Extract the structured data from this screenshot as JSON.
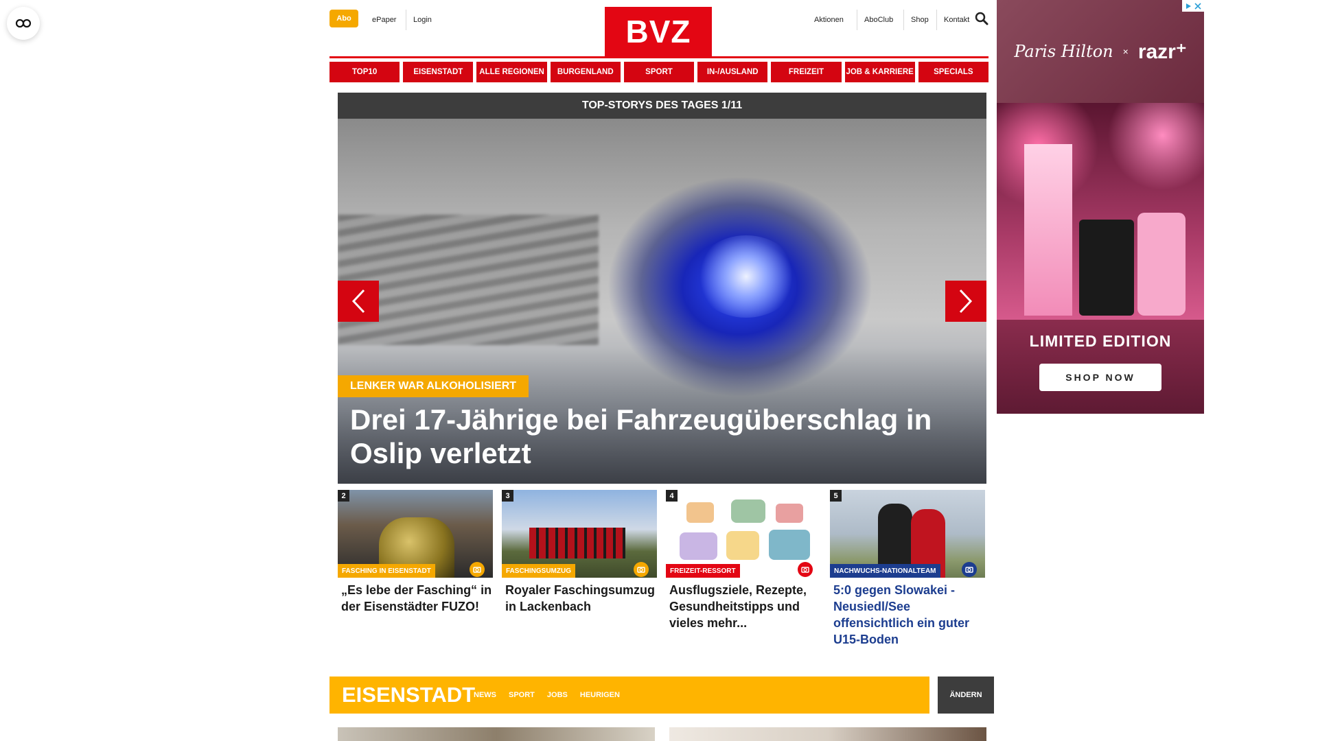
{
  "header": {
    "abo_label": "Abo",
    "left_links": [
      "ePaper",
      "Login"
    ],
    "logo_text": "BVZ",
    "right_links": [
      "Aktionen",
      "AboClub",
      "Shop",
      "Kontakt"
    ]
  },
  "nav": {
    "items": [
      "TOP10",
      "EISENSTADT",
      "ALLE REGIONEN",
      "BURGENLAND",
      "SPORT",
      "IN-/AUSLAND",
      "FREIZEIT",
      "JOB & KARRIERE",
      "SPECIALS"
    ]
  },
  "top_stories": {
    "heading": "TOP-STORYS DES TAGES 1/11",
    "kicker": "LENKER WAR ALKOHOLISIERT",
    "title": "Drei 17-Jährige bei Fahrzeugüberschlag in Oslip verletzt"
  },
  "teasers": [
    {
      "number": "2",
      "tag": "FASCHING IN EISENSTADT",
      "title": "„Es lebe der Fasching“ in der Eisenstädter FUZO!",
      "tag_color": "#f5a800"
    },
    {
      "number": "3",
      "tag": "FASCHINGSUMZUG",
      "title": "Royaler Faschingsumzug in Lackenbach",
      "tag_color": "#f5a800"
    },
    {
      "number": "4",
      "tag": "FREIZEIT-RESSORT",
      "title": "Ausflugsziele, Rezepte, Gesundheitstipps und vieles mehr...",
      "tag_color": "#e30613"
    },
    {
      "number": "5",
      "tag": "NACHWUCHS-NATIONALTEAM",
      "title": "5:0 gegen Slowakei - Neusiedl/See offensichtlich ein guter U15-Boden",
      "tag_color": "#1c3d8f"
    }
  ],
  "ad": {
    "script_text": "Paris Hilton",
    "x_text": "×",
    "brand": "razr⁺",
    "headline": "LIMITED EDITION",
    "cta": "SHOP NOW"
  },
  "region": {
    "name": "EISENSTADT",
    "links": [
      "NEWS",
      "SPORT",
      "JOBS",
      "HEURIGEN"
    ],
    "change_label": "ÄNDERN"
  },
  "colors": {
    "brand_red": "#e30613",
    "accent_yellow": "#f5a800",
    "region_yellow": "#ffb400",
    "sport_blue": "#1c3d8f"
  }
}
